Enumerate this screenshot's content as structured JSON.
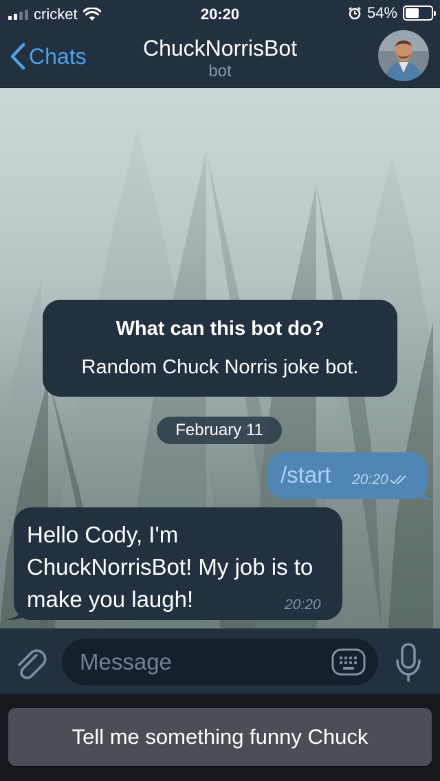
{
  "status_bar": {
    "carrier": "cricket",
    "time": "20:20",
    "battery_percent": "54%",
    "battery_level": 0.54,
    "signal_bars": 2
  },
  "nav": {
    "back_label": "Chats",
    "title": "ChuckNorrisBot",
    "subtitle": "bot"
  },
  "bot_info": {
    "title": "What can this bot do?",
    "description": "Random Chuck Norris joke bot."
  },
  "date_separator": "February 11",
  "messages": [
    {
      "direction": "outgoing",
      "text": "/start",
      "time": "20:20",
      "status": "read"
    },
    {
      "direction": "incoming",
      "text": "Hello Cody, I'm ChuckNorrisBot! My job is to make you laugh!",
      "time": "20:20"
    }
  ],
  "input": {
    "placeholder": "Message",
    "value": ""
  },
  "reply_keyboard": {
    "buttons": [
      "Tell me something funny Chuck"
    ]
  },
  "colors": {
    "accent": "#4ea2ea",
    "header_bg": "#223040",
    "outgoing_bubble": "#4f86b4",
    "incoming_bubble": "#223040"
  },
  "icons": [
    "signal-icon",
    "wifi-icon",
    "alarm-icon",
    "battery-icon",
    "back-chevron-icon",
    "paperclip-icon",
    "keyboard-icon",
    "microphone-icon",
    "double-check-icon"
  ]
}
